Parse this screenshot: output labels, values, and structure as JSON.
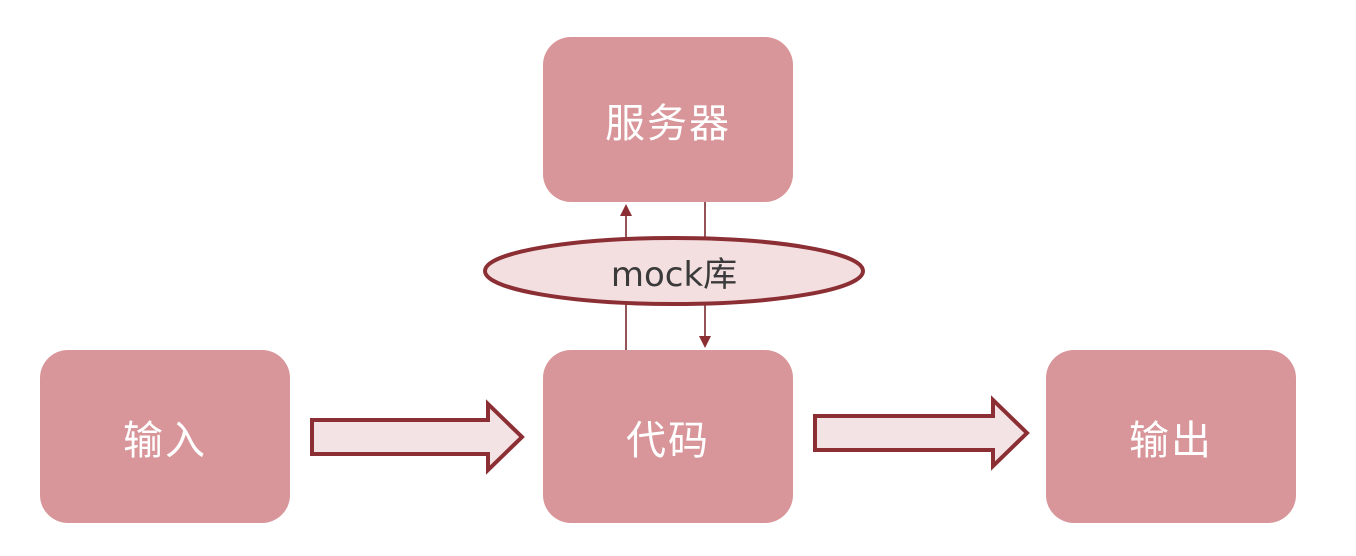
{
  "nodes": {
    "server": "服务器",
    "input": "输入",
    "code": "代码",
    "output": "输出"
  },
  "mock_library": "mock库",
  "colors": {
    "node_fill": "#d9969a",
    "node_text": "#ffffff",
    "arrow_fill": "#f4e3e4",
    "arrow_stroke": "#8b2f34",
    "ellipse_fill": "#f4dfe0",
    "ellipse_stroke": "#8b2f34",
    "label_text": "#3a3a3a"
  }
}
